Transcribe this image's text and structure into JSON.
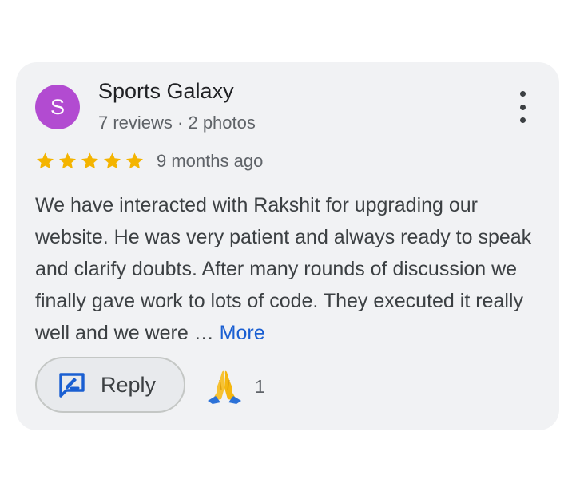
{
  "reviewer": {
    "avatar_letter": "S",
    "avatar_color": "#b24bd1",
    "name": "Sports Galaxy",
    "meta": "7 reviews · 2 photos"
  },
  "menu_icon": "more-vertical-icon",
  "rating": {
    "stars": 5,
    "max": 5,
    "star_color": "#f4b400",
    "time_ago": "9 months ago"
  },
  "review": {
    "text": "We have interacted with Rakshit for upgrading our website. He was very patient and always ready to speak and clarify doubts. After many rounds of discussion we finally gave work to lots of code. They executed it really well and we were",
    "ellipsis": "…",
    "more_label": "More"
  },
  "actions": {
    "reply_label": "Reply",
    "reply_icon": "reply-comment-icon",
    "reaction_icon": "folded-hands-icon",
    "reaction_count": "1"
  },
  "colors": {
    "card_background": "#f1f2f4",
    "link": "#1a5fd2",
    "reply_icon": "#1a5fd2"
  }
}
